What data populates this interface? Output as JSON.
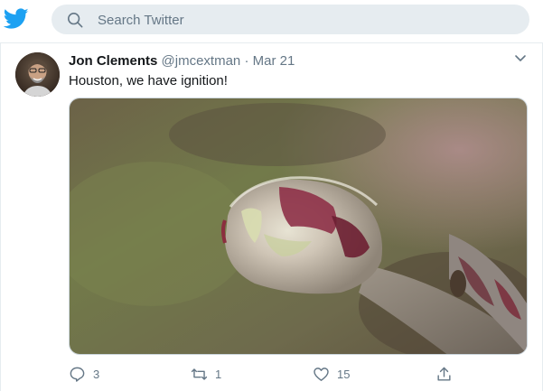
{
  "search": {
    "placeholder": "Search Twitter"
  },
  "tweet": {
    "author_name": "Jon Clements",
    "author_handle": "@jmcextman",
    "separator": "·",
    "date": "Mar 21",
    "text": "Houston, we have ignition!",
    "stats": {
      "replies": "3",
      "retweets": "1",
      "likes": "15"
    }
  },
  "colors": {
    "brand": "#1da1f2",
    "secondary_text": "#657786",
    "search_bg": "#e6ecf0"
  },
  "icons": [
    "twitter-bird-icon",
    "search-icon",
    "chevron-down-icon",
    "reply-icon",
    "retweet-icon",
    "like-icon",
    "share-icon"
  ]
}
